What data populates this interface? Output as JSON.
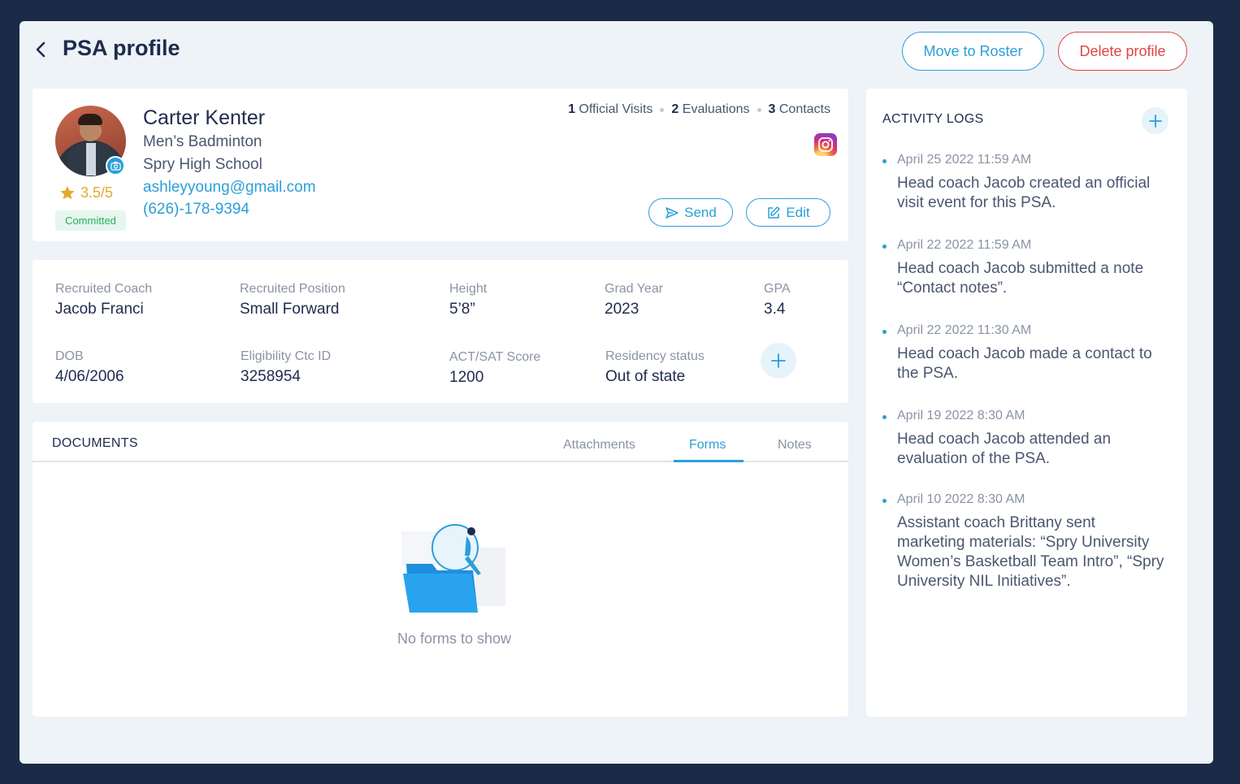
{
  "header": {
    "title": "PSA profile",
    "move_to_roster_label": "Move to Roster",
    "delete_profile_label": "Delete profile"
  },
  "profile": {
    "name": "Carter Kenter",
    "sport": "Men’s Badminton",
    "school": "Spry High School",
    "email": "ashleyyoung@gmail.com",
    "phone": "(626)-178-9394",
    "rating": "3.5/5",
    "status": "Committed",
    "stats": [
      {
        "count": "1",
        "label": "Official Visits"
      },
      {
        "count": "2",
        "label": "Evaluations"
      },
      {
        "count": "3",
        "label": "Contacts"
      }
    ],
    "send_label": "Send",
    "edit_label": "Edit"
  },
  "details": {
    "recruited_coach": {
      "label": "Recruited Coach",
      "value": "Jacob Franci"
    },
    "recruited_position": {
      "label": "Recruited Position",
      "value": "Small Forward"
    },
    "height": {
      "label": "Height",
      "value": "5’8”"
    },
    "grad_year": {
      "label": "Grad Year",
      "value": "2023"
    },
    "gpa": {
      "label": "GPA",
      "value": "3.4"
    },
    "dob": {
      "label": "DOB",
      "value": "4/06/2006"
    },
    "eligibility_id": {
      "label": "Eligibility Ctc ID",
      "value": "3258954"
    },
    "act_sat": {
      "label": "ACT/SAT Score",
      "value": "1200"
    },
    "residency": {
      "label": "Residency status",
      "value": "Out of state"
    }
  },
  "documents": {
    "title": "DOCUMENTS",
    "tabs": [
      "Attachments",
      "Forms",
      "Notes"
    ],
    "active_tab": "Forms",
    "empty_text": "No forms to show"
  },
  "activity": {
    "title": "ACTIVITY LOGS",
    "logs": [
      {
        "time": "April 25 2022  11:59 AM",
        "text": "Head coach Jacob created an official visit event for this PSA."
      },
      {
        "time": "April 22 2022  11:59 AM",
        "text": "Head coach Jacob submitted a note “Contact notes”."
      },
      {
        "time": "April 22 2022  11:30 AM",
        "text": "Head coach Jacob made a contact to the PSA."
      },
      {
        "time": "April 19 2022  8:30 AM",
        "text": "Head coach Jacob attended an evaluation of the PSA."
      },
      {
        "time": "April 10 2022  8:30 AM",
        "text": "Assistant coach Brittany sent marketing materials: “Spry University Women’s Basketball Team Intro”, “Spry University NIL Initiatives”."
      }
    ]
  },
  "colors": {
    "accent": "#2a9fd8",
    "danger": "#e14444",
    "success": "#27ae60",
    "star": "#e6a82b",
    "frame": "#1b2b47"
  },
  "icons": {
    "back": "chevron-left-icon",
    "camera": "camera-icon",
    "star": "star-icon",
    "instagram": "instagram-icon",
    "send": "send-icon",
    "edit": "edit-icon",
    "add": "plus-icon"
  }
}
